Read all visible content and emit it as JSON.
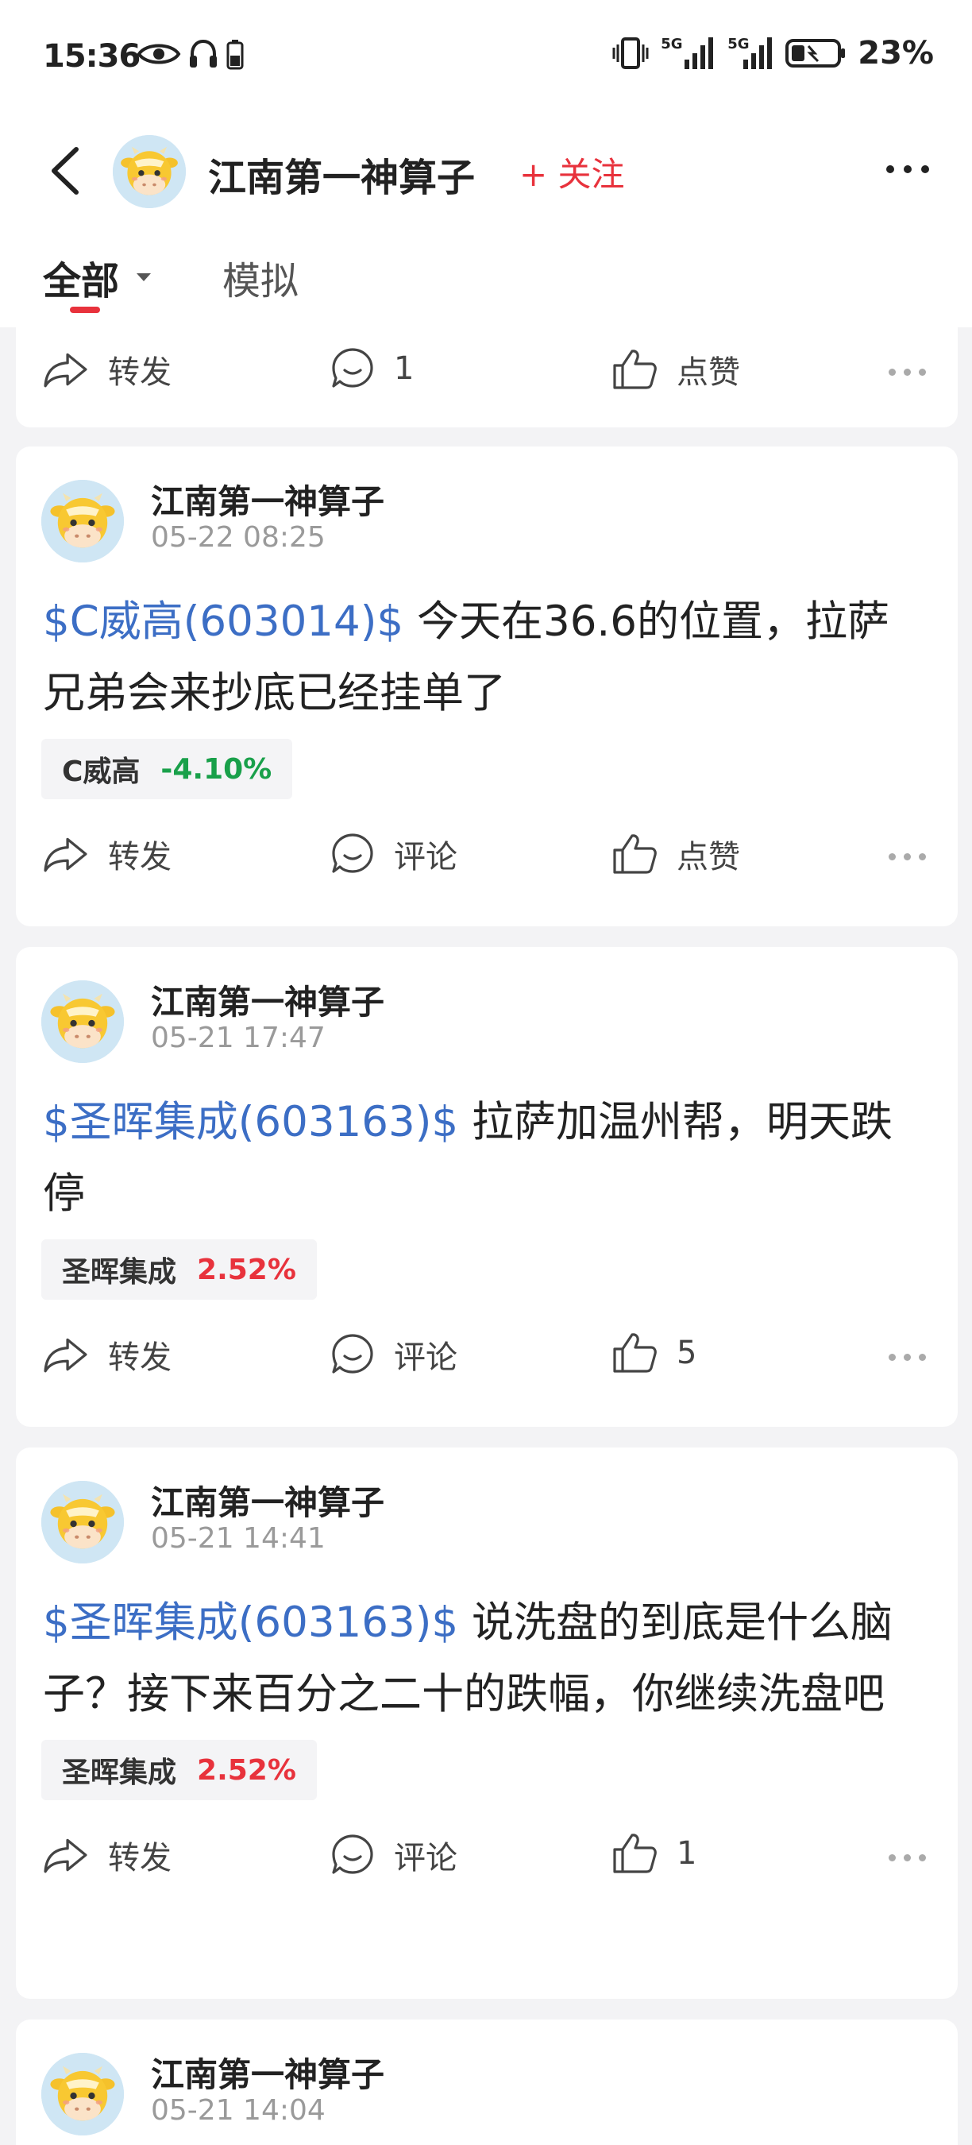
{
  "status_bar": {
    "time": "15:36",
    "battery": "23%",
    "signal1_label": "5G",
    "signal2_label": "5G",
    "icons": [
      "eye-icon",
      "headphones-icon",
      "battery-small-icon",
      "vibrate-icon",
      "signal-icon",
      "signal-icon",
      "battery-icon"
    ]
  },
  "header": {
    "title": "江南第一神算子",
    "follow_label": "+ 关注"
  },
  "tabs": {
    "all": "全部",
    "simulated": "模拟"
  },
  "colors": {
    "accent_red": "#e8323c",
    "stock_link_blue": "#3c6ec5",
    "down_green": "#19a04a"
  },
  "top_card": {
    "forward": "转发",
    "comment": "1",
    "like": "点赞"
  },
  "posts": [
    {
      "author": "江南第一神算子",
      "time": "05-22 08:25",
      "tag": "$C威高(603014)$",
      "text": " 今天在36.6的位置，拉萨兄弟会来抄底已经挂单了",
      "stock_name": "C威高",
      "stock_change": "-4.10%",
      "forward": "转发",
      "comment": "评论",
      "like": "点赞"
    },
    {
      "author": "江南第一神算子",
      "time": "05-21 17:47",
      "tag": "$圣晖集成(603163)$",
      "text": " 拉萨加温州帮，明天跌停",
      "stock_name": "圣晖集成",
      "stock_change": "2.52%",
      "forward": "转发",
      "comment": "评论",
      "like": "5"
    },
    {
      "author": "江南第一神算子",
      "time": "05-21 14:41",
      "tag": "$圣晖集成(603163)$",
      "text": " 说洗盘的到底是什么脑子？接下来百分之二十的跌幅，你继续洗盘吧",
      "stock_name": "圣晖集成",
      "stock_change": "2.52%",
      "forward": "转发",
      "comment": "评论",
      "like": "1"
    },
    {
      "author": "江南第一神算子",
      "time": "05-21 14:04"
    }
  ]
}
